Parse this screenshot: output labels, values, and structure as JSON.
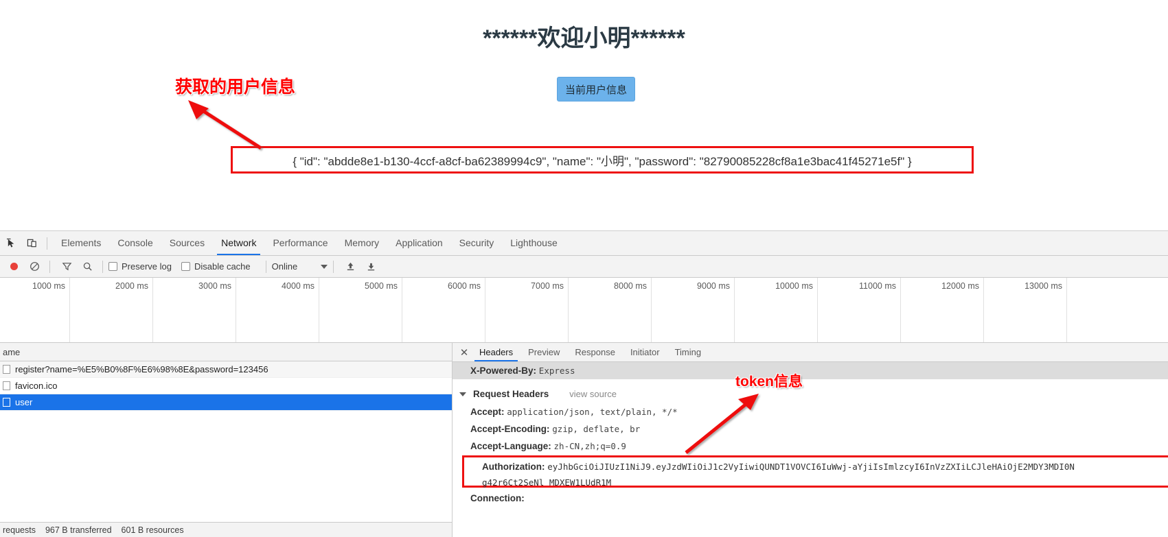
{
  "page": {
    "welcome_title": "******欢迎小明******",
    "info_button_label": "当前用户信息",
    "json_output": "{ \"id\": \"abdde8e1-b130-4ccf-a8cf-ba62389994c9\", \"name\": \"小明\", \"password\": \"82790085228cf8a1e3bac41f45271e5f\" }"
  },
  "annotations": {
    "user_info_label": "获取的用户信息",
    "token_label": "token信息",
    "color": "#ff0000"
  },
  "devtools": {
    "tabs": [
      {
        "label": "Elements",
        "active": false
      },
      {
        "label": "Console",
        "active": false
      },
      {
        "label": "Sources",
        "active": false
      },
      {
        "label": "Network",
        "active": true
      },
      {
        "label": "Performance",
        "active": false
      },
      {
        "label": "Memory",
        "active": false
      },
      {
        "label": "Application",
        "active": false
      },
      {
        "label": "Security",
        "active": false
      },
      {
        "label": "Lighthouse",
        "active": false
      }
    ],
    "filterbar": {
      "preserve_log_label": "Preserve log",
      "disable_cache_label": "Disable cache",
      "throttling_value": "Online",
      "record_icon": "record-icon",
      "clear_icon": "clear-icon",
      "filter_icon": "filter-icon",
      "search_icon": "search-icon",
      "import_icon": "import-har-icon",
      "export_icon": "export-har-icon"
    },
    "timeline": {
      "ticks": [
        "1000 ms",
        "2000 ms",
        "3000 ms",
        "4000 ms",
        "5000 ms",
        "6000 ms",
        "7000 ms",
        "8000 ms",
        "9000 ms",
        "10000 ms",
        "11000 ms",
        "12000 ms",
        "13000 ms"
      ]
    },
    "requests": {
      "column_header": "ame",
      "rows": [
        {
          "name": "register?name=%E5%B0%8F%E6%98%8E&password=123456",
          "selected": false
        },
        {
          "name": "favicon.ico",
          "selected": false
        },
        {
          "name": "user",
          "selected": true
        }
      ]
    },
    "status_bar": {
      "requests": "requests",
      "transferred": "967 B transferred",
      "resources": "601 B resources"
    },
    "detail": {
      "tabs": [
        {
          "label": "Headers",
          "active": true
        },
        {
          "label": "Preview",
          "active": false
        },
        {
          "label": "Response",
          "active": false
        },
        {
          "label": "Initiator",
          "active": false
        },
        {
          "label": "Timing",
          "active": false
        }
      ],
      "response_header": {
        "name": "X-Powered-By:",
        "value": "Express"
      },
      "request_headers_title": "Request Headers",
      "view_source_label": "view source",
      "headers": [
        {
          "name": "Accept:",
          "value": "application/json, text/plain, */*"
        },
        {
          "name": "Accept-Encoding:",
          "value": "gzip, deflate, br"
        },
        {
          "name": "Accept-Language:",
          "value": "zh-CN,zh;q=0.9"
        }
      ],
      "authorization": {
        "name": "Authorization:",
        "value_line1": "eyJhbGciOiJIUzI1NiJ9.eyJzdWIiOiJ1c2VyIiwiQUNDT1VOVCI6IuWwj-aYjiIsImlzcyI6InVzZXIiLCJleHAiOjE2MDY3MDI0N",
        "value_line2": "g42r6Ct2SeNl MDXEW1LUdR1M"
      },
      "next_header_partial": "Connection:"
    }
  }
}
